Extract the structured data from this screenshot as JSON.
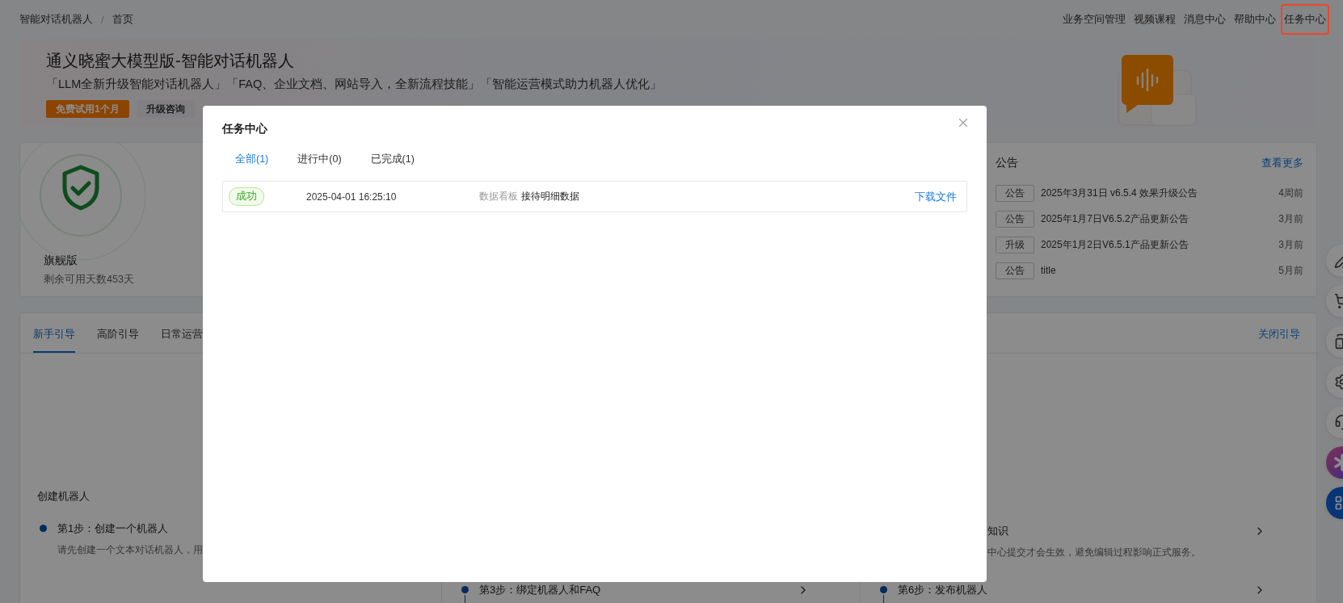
{
  "breadcrumb": {
    "items": [
      "智能对话机器人",
      "首页"
    ],
    "separator": "/"
  },
  "top_nav": [
    {
      "label": "业务空间管理",
      "highlighted": false
    },
    {
      "label": "视频课程",
      "highlighted": false
    },
    {
      "label": "消息中心",
      "highlighted": false
    },
    {
      "label": "帮助中心",
      "highlighted": false
    },
    {
      "label": "任务中心",
      "highlighted": true
    }
  ],
  "banner": {
    "title": "通义晓蜜大模型版-智能对话机器人",
    "tagline": "「LLM全新升级智能对话机器人」「FAQ、企业文档、网站导入，全新流程技能」「智能运营模式助力机器人优化」",
    "buttons": [
      {
        "label": "免费试用1个月",
        "kind": "primary"
      },
      {
        "label": "升级咨询",
        "kind": "secondary"
      }
    ]
  },
  "plan_card": {
    "name": "旗舰版",
    "remaining": "剩余可用天数453天"
  },
  "announcements": {
    "title": "公告",
    "more_link": "查看更多",
    "items": [
      {
        "tag": "公告",
        "title": "2025年3月31日 v6.5.4 效果升级公告",
        "time": "4周前"
      },
      {
        "tag": "公告",
        "title": "2025年1月7日V6.5.2产品更新公告",
        "time": "3月前"
      },
      {
        "tag": "升级",
        "title": "2025年1月2日V6.5.1产品更新公告",
        "time": "3月前"
      },
      {
        "tag": "公告",
        "title": "title",
        "time": "5月前"
      }
    ]
  },
  "guide": {
    "tabs": [
      {
        "label": "新手引导",
        "selected": true
      },
      {
        "label": "高阶引导",
        "selected": false
      },
      {
        "label": "日常运营",
        "selected": false
      }
    ],
    "close_link": "关闭引导",
    "columns": [
      {
        "heading": "创建机器人",
        "steps": [
          {
            "kind": "left",
            "title": "第1步：创建一个机器人",
            "description": "请先创建一个文本对话机器人，用",
            "connector": false
          }
        ]
      },
      {
        "steps": [
          {
            "kind": "whole",
            "title": "第3步：绑定机器人和FAQ",
            "connector": true
          }
        ]
      },
      {
        "steps": [
          {
            "kind": "right",
            "title": "知识",
            "description": "中心提交才会生效，避免编辑过程影响正式服务。"
          },
          {
            "kind": "whole",
            "title": "第6步：发布机器人",
            "connector": true
          }
        ]
      }
    ]
  },
  "modal": {
    "title": "任务中心",
    "tabs": [
      {
        "label": "全部(1)",
        "selected": true
      },
      {
        "label": "进行中(0)",
        "selected": false
      },
      {
        "label": "已完成(1)",
        "selected": false
      }
    ],
    "tasks": [
      {
        "status": "成功",
        "time": "2025-04-01 16:25:10",
        "category": "数据看板",
        "name": "接待明细数据",
        "action": "下载文件"
      }
    ]
  }
}
